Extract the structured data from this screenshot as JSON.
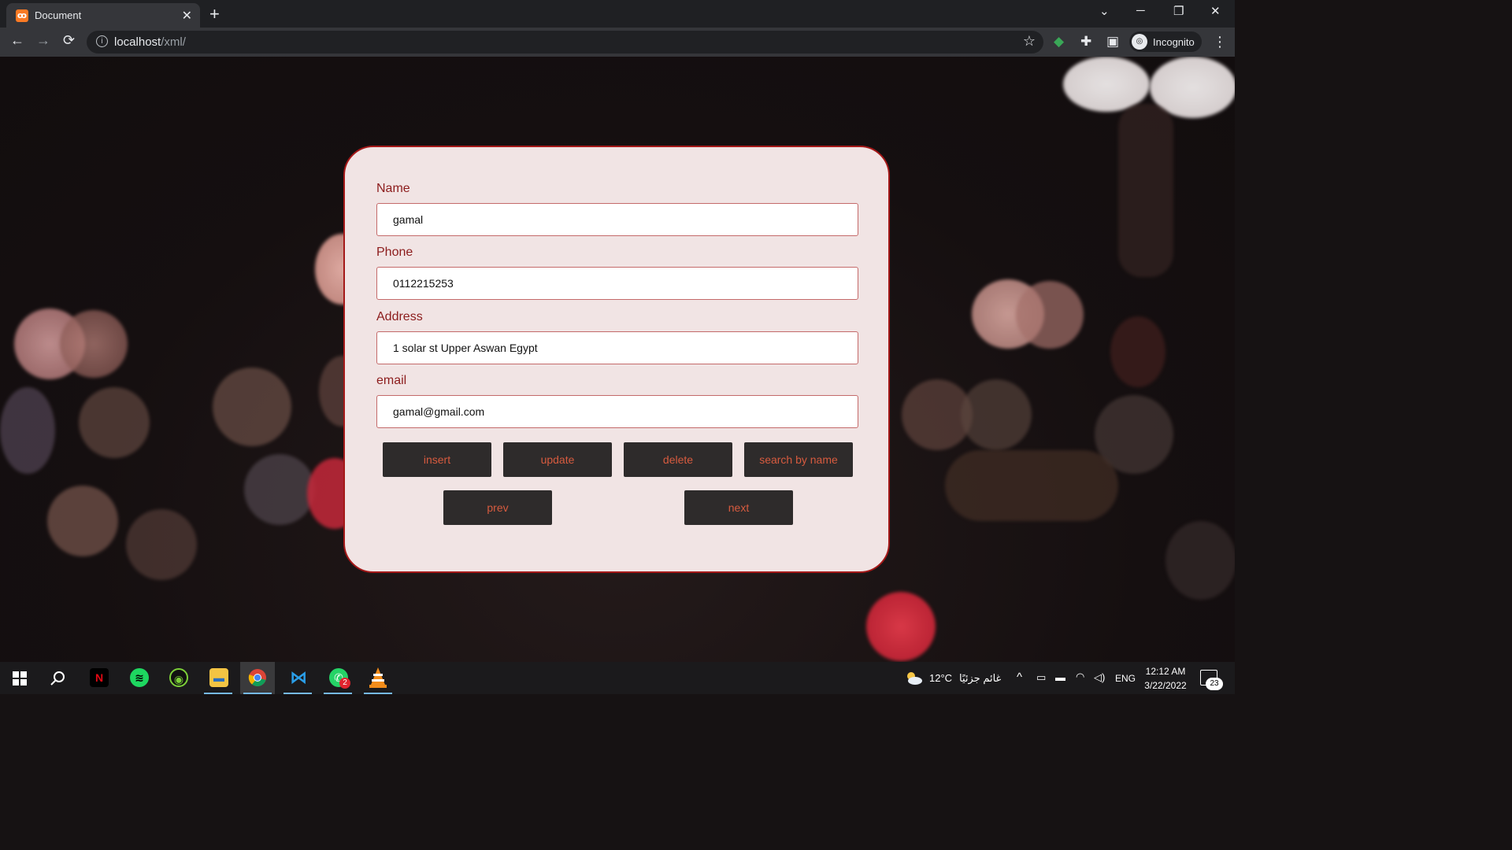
{
  "browser": {
    "tab_title": "Document",
    "tab_close": "✕",
    "new_tab": "+",
    "url_host": "localhost",
    "url_path": "/xml/",
    "profile_label": "Incognito",
    "back": "←",
    "forward": "→",
    "reload": "⟳",
    "star": "☆",
    "menu": "⋮",
    "minimize": "─",
    "restore": "❐",
    "close": "✕",
    "tab_search": "⌄"
  },
  "form": {
    "fields": [
      {
        "label": "Name",
        "value": "gamal"
      },
      {
        "label": "Phone",
        "value": "0112215253"
      },
      {
        "label": "Address",
        "value": "1 solar st Upper Aswan Egypt"
      },
      {
        "label": "email",
        "value": "gamal@gmail.com"
      }
    ],
    "buttons": {
      "insert": "insert",
      "update": "update",
      "delete": "delete",
      "search": "search by name",
      "prev": "prev",
      "next": "next"
    }
  },
  "taskbar": {
    "weather_temp": "12°C",
    "weather_desc": "غائم جزئيًا",
    "language": "ENG",
    "time": "12:12 AM",
    "date": "3/22/2022",
    "notification_count": "23",
    "whatsapp_badge": "2"
  },
  "colors": {
    "accent": "#a41818",
    "label": "#8c1c1c",
    "button_bg": "#2e2b2b",
    "button_text": "#d75b3f",
    "card_bg": "#f1e4e4"
  }
}
